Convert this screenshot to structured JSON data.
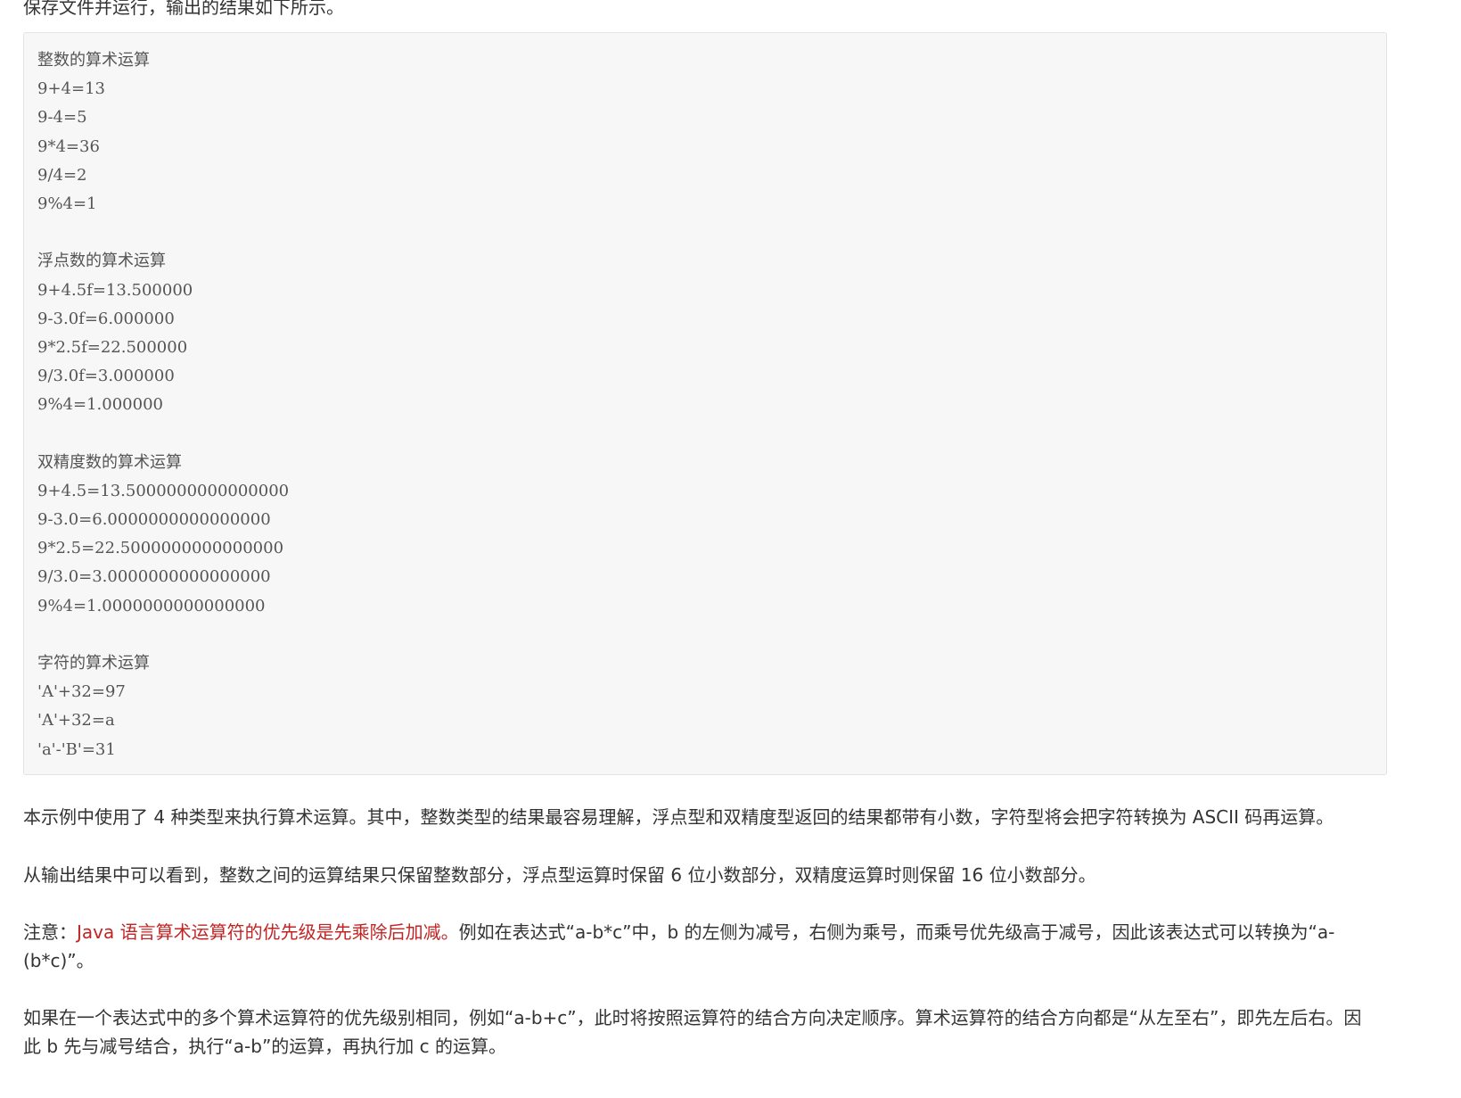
{
  "intro_text": "保存文件并运行，输出的结果如下所示。",
  "code_output": {
    "lines": [
      "整数的算术运算",
      "9+4=13",
      "9-4=5",
      "9*4=36",
      "9/4=2",
      "9%4=1",
      "",
      "浮点数的算术运算",
      "9+4.5f=13.500000",
      "9-3.0f=6.000000",
      "9*2.5f=22.500000",
      "9/3.0f=3.000000",
      "9%4=1.000000",
      "",
      "双精度数的算术运算",
      "9+4.5=13.5000000000000000",
      "9-3.0=6.0000000000000000",
      "9*2.5=22.5000000000000000",
      "9/3.0=3.0000000000000000",
      "9%4=1.0000000000000000",
      "",
      "字符的算术运算",
      "'A'+32=97",
      "'A'+32=a",
      "'a'-'B'=31"
    ]
  },
  "paragraphs": {
    "p1": "本示例中使用了 4 种类型来执行算术运算。其中，整数类型的结果最容易理解，浮点型和双精度型返回的结果都带有小数，字符型将会把字符转换为 ASCII 码再运算。",
    "p2": "从输出结果中可以看到，整数之间的运算结果只保留整数部分，浮点型运算时保留 6 位小数部分，双精度运算时则保留 16 位小数部分。",
    "p3_prefix": "注意：",
    "p3_highlight": "Java 语言算术运算符的优先级是先乘除后加减。",
    "p3_rest": "例如在表达式“a-b*c”中，b 的左侧为减号，右侧为乘号，而乘号优先级高于减号，因此该表达式可以转换为“a-(b*c)”。",
    "p4": "如果在一个表达式中的多个算术运算符的优先级别相同，例如“a-b+c”，此时将按照运算符的结合方向决定顺序。算术运算符的结合方向都是“从左至右”，即先左后右。因此 b 先与减号结合，执行“a-b”的运算，再执行加 c 的运算。"
  },
  "colors": {
    "highlight": "#c02424",
    "code_background": "#f7f7f7"
  }
}
